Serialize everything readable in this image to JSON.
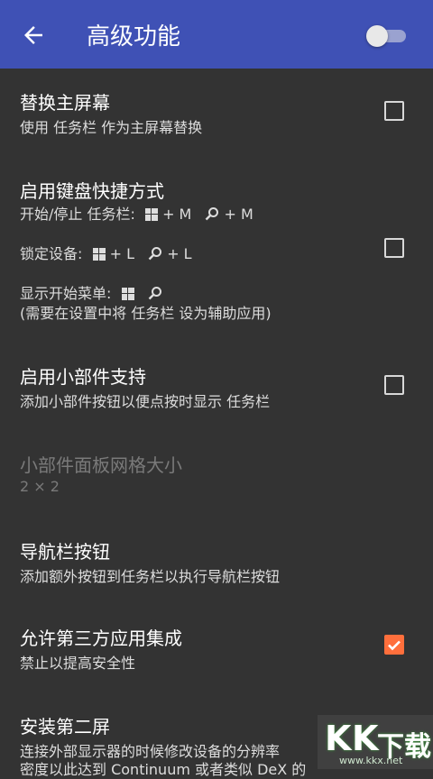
{
  "appbar": {
    "title": "高级功能",
    "back_icon": "arrow-left-icon",
    "switch_state": "off"
  },
  "items": {
    "replace_home": {
      "title": "替换主屏幕",
      "summary": "使用 任务栏 作为主屏幕替换",
      "checked": false
    },
    "keyboard": {
      "title": "启用键盘快捷方式",
      "start_stop_label": "开始/停止 任务栏:",
      "start_stop_win": "+ M",
      "start_stop_search": "+ M",
      "lock_label": "锁定设备:",
      "lock_win": "+ L",
      "lock_search": "+ L",
      "menu_label": "显示开始菜单:",
      "menu_note": "(需要在设置中将 任务栏 设为辅助应用)",
      "checked": false
    },
    "widgets": {
      "title": "启用小部件支持",
      "summary": "添加小部件按钮以便点按时显示 任务栏",
      "checked": false
    },
    "grid_size": {
      "title": "小部件面板网格大小",
      "summary": "2 × 2"
    },
    "nav_buttons": {
      "title": "导航栏按钮",
      "summary": "添加额外按钮到任务栏以执行导航栏按钮"
    },
    "third_party": {
      "title": "允许第三方应用集成",
      "summary": "禁止以提高安全性",
      "checked": true
    },
    "second_screen": {
      "title": "安装第二屏",
      "summary1": "连接外部显示器的时候修改设备的分辨率",
      "summary2": "密度以此达到 Continuum 或者类似 DeX 的"
    }
  },
  "watermark": {
    "text1": "K",
    "text2": "K",
    "text3": "下载",
    "url": "www.kkx.net"
  },
  "colors": {
    "appbar": "#3f51b5",
    "background": "#333333",
    "accent": "#ff6f3c"
  }
}
